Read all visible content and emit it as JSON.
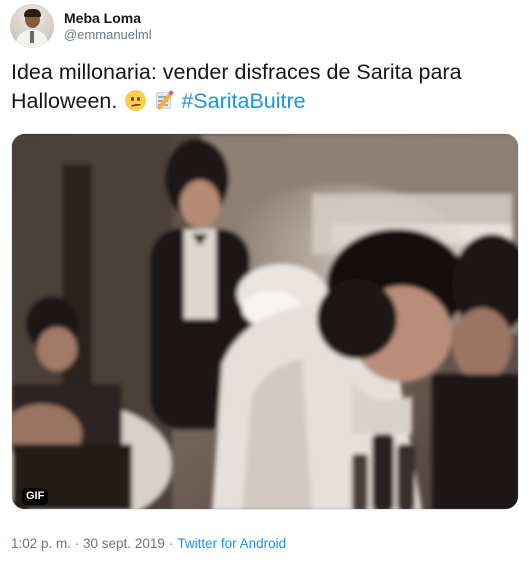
{
  "user": {
    "display_name": "Meba Loma",
    "handle": "@emmanuelml"
  },
  "tweet": {
    "text": "Idea millonaria: vender disfraces de Sarita para Halloween.",
    "emojis": [
      "woozy-face-icon",
      "memo-icon"
    ],
    "hashtag": "#SaritaBuitre"
  },
  "media": {
    "badge": "GIF"
  },
  "meta": {
    "timestamp": "1:02 p. m. · 30 sept. 2019",
    "separator": "·",
    "source": "Twitter for Android"
  },
  "colors": {
    "link": "#1b95e0",
    "secondary_text": "#657786",
    "primary_text": "#14171a"
  }
}
